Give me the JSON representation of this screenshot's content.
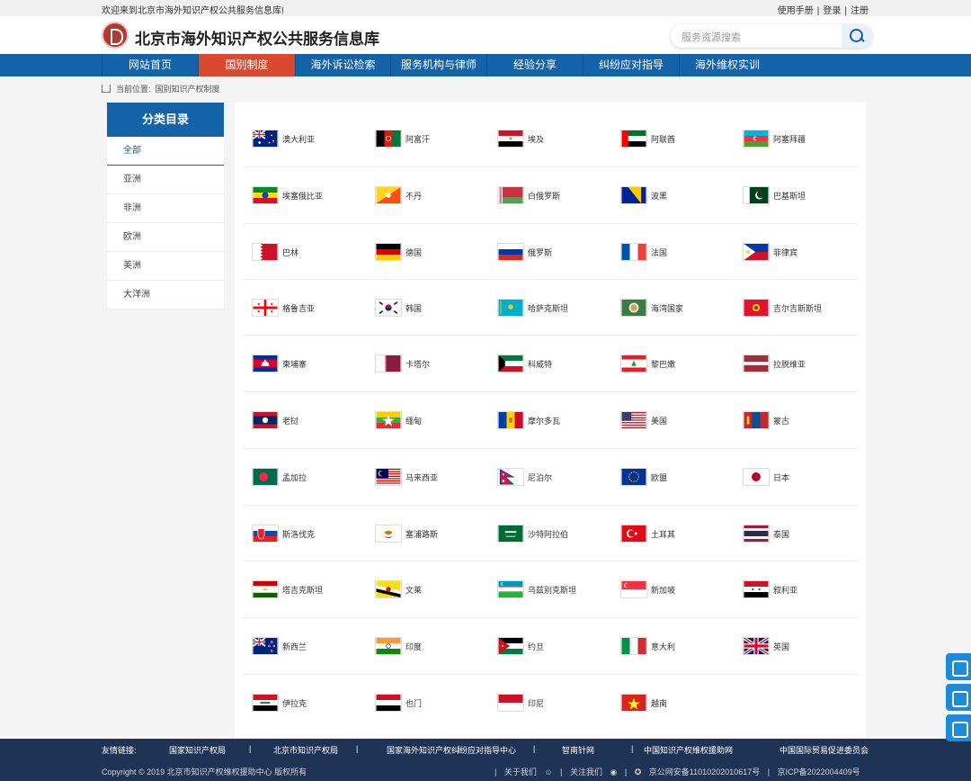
{
  "topbar": {
    "welcome": "欢迎来到北京市海外知识产权公共服务信息库!",
    "manual": "使用手册",
    "login": "登录",
    "register": "注册",
    "sep": "|"
  },
  "header": {
    "title": "北京市海外知识产权公共服务信息库",
    "search_placeholder": "服务资源搜索"
  },
  "nav": [
    "网站首页",
    "国别制度",
    "海外诉讼检索",
    "服务机构与律师",
    "经验分享",
    "纠纷应对指导",
    "海外维权实训"
  ],
  "nav_active": "国别制度",
  "breadcrumb": {
    "label": "当前位置:",
    "path": "国别知识产权制度"
  },
  "sidebar": {
    "title": "分类目录",
    "categories": [
      "全部",
      "亚洲",
      "非洲",
      "欧洲",
      "美洲",
      "大洋洲"
    ],
    "active": "全部"
  },
  "countries": [
    {
      "name": "澳大利亚",
      "flag": "australia"
    },
    {
      "name": "阿富汗",
      "flag": "afghanistan"
    },
    {
      "name": "埃及",
      "flag": "egypt"
    },
    {
      "name": "阿联酋",
      "flag": "uae"
    },
    {
      "name": "阿塞拜疆",
      "flag": "azerbaijan"
    },
    {
      "name": "埃塞俄比亚",
      "flag": "ethiopia"
    },
    {
      "name": "不丹",
      "flag": "bhutan"
    },
    {
      "name": "白俄罗斯",
      "flag": "belarus"
    },
    {
      "name": "波黑",
      "flag": "bosnia"
    },
    {
      "name": "巴基斯坦",
      "flag": "pakistan"
    },
    {
      "name": "巴林",
      "flag": "bahrain"
    },
    {
      "name": "德国",
      "flag": "germany"
    },
    {
      "name": "俄罗斯",
      "flag": "russia"
    },
    {
      "name": "法国",
      "flag": "france"
    },
    {
      "name": "菲律宾",
      "flag": "philippines"
    },
    {
      "name": "格鲁吉亚",
      "flag": "georgia"
    },
    {
      "name": "韩国",
      "flag": "korea"
    },
    {
      "name": "哈萨克斯坦",
      "flag": "kazakhstan"
    },
    {
      "name": "海湾国家",
      "flag": "gcc"
    },
    {
      "name": "吉尔吉斯斯坦",
      "flag": "kyrgyzstan"
    },
    {
      "name": "柬埔寨",
      "flag": "cambodia"
    },
    {
      "name": "卡塔尔",
      "flag": "qatar"
    },
    {
      "name": "科威特",
      "flag": "kuwait"
    },
    {
      "name": "黎巴嫩",
      "flag": "lebanon"
    },
    {
      "name": "拉脱维亚",
      "flag": "latvia"
    },
    {
      "name": "老挝",
      "flag": "laos"
    },
    {
      "name": "缅甸",
      "flag": "myanmar"
    },
    {
      "name": "摩尔多瓦",
      "flag": "moldova"
    },
    {
      "name": "美国",
      "flag": "usa"
    },
    {
      "name": "蒙古",
      "flag": "mongolia"
    },
    {
      "name": "孟加拉",
      "flag": "bangladesh"
    },
    {
      "name": "马来西亚",
      "flag": "malaysia"
    },
    {
      "name": "尼泊尔",
      "flag": "nepal"
    },
    {
      "name": "欧盟",
      "flag": "eu"
    },
    {
      "name": "日本",
      "flag": "japan"
    },
    {
      "name": "斯洛伐克",
      "flag": "slovakia"
    },
    {
      "name": "塞浦路斯",
      "flag": "cyprus"
    },
    {
      "name": "沙特阿拉伯",
      "flag": "saudi"
    },
    {
      "name": "土耳其",
      "flag": "turkey"
    },
    {
      "name": "泰国",
      "flag": "thailand"
    },
    {
      "name": "塔吉克斯坦",
      "flag": "tajikistan"
    },
    {
      "name": "文莱",
      "flag": "brunei"
    },
    {
      "name": "乌兹别克斯坦",
      "flag": "uzbekistan"
    },
    {
      "name": "新加坡",
      "flag": "singapore"
    },
    {
      "name": "叙利亚",
      "flag": "syria"
    },
    {
      "name": "新西兰",
      "flag": "newzealand"
    },
    {
      "name": "印度",
      "flag": "india"
    },
    {
      "name": "约旦",
      "flag": "jordan"
    },
    {
      "name": "意大利",
      "flag": "italy"
    },
    {
      "name": "英国",
      "flag": "uk"
    },
    {
      "name": "伊拉克",
      "flag": "iraq"
    },
    {
      "name": "也门",
      "flag": "yemen"
    },
    {
      "name": "印尼",
      "flag": "indonesia"
    },
    {
      "name": "越南",
      "flag": "vietnam"
    }
  ],
  "footer": {
    "links_label": "友情链接:",
    "links": [
      "国家知识产权局",
      "北京市知识产权局",
      "国家海外知识产权纠纷应对指导中心",
      "智南针网",
      "中国知识产权维权援助网",
      "中国国际贸易促进委员会"
    ],
    "sep": "|",
    "copyright": "Copyright © 2019 北京市知识产权维权援助中心 版权所有",
    "about": "关于我们",
    "follow": "关注我们",
    "police": "京公网安备11010202010617号",
    "icp": "京ICP备2022004409号"
  },
  "floating_buttons": [
    "translate-icon",
    "clipboard-icon",
    "chat-icon"
  ],
  "colors": {
    "primary": "#1462a8",
    "active": "#d9492f",
    "footer": "#1f3354"
  }
}
